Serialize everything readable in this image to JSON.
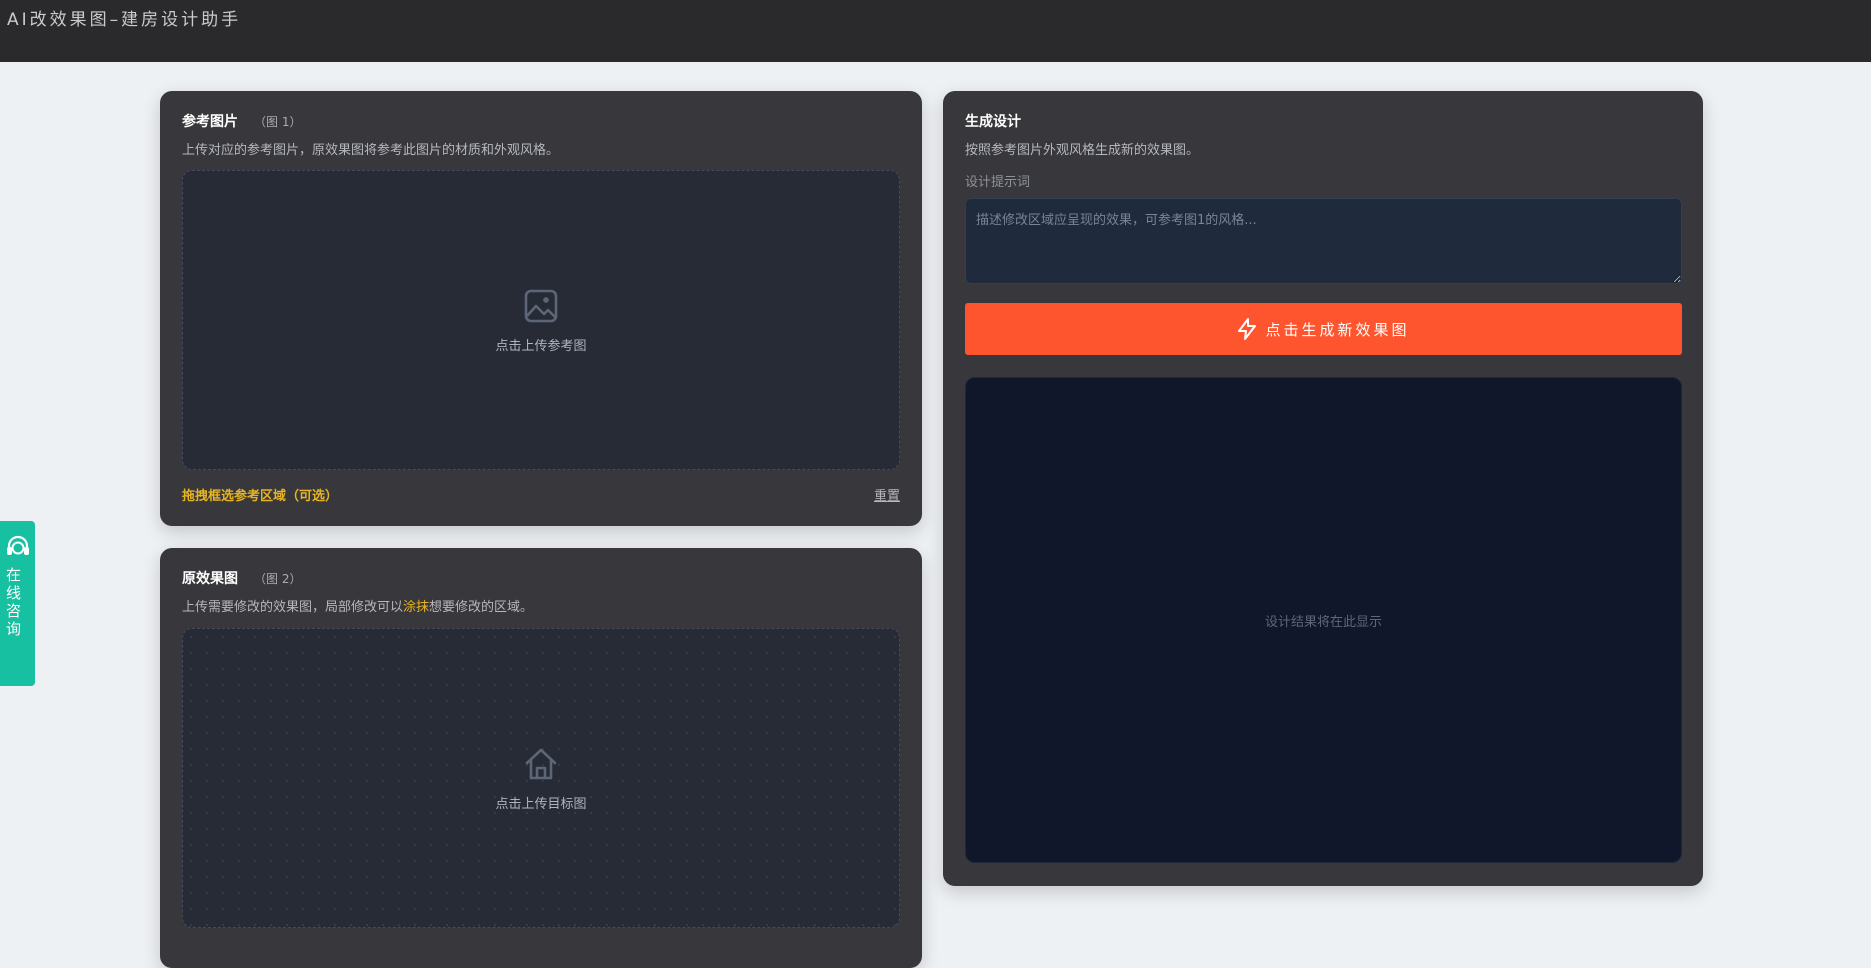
{
  "app": {
    "title": "AI改效果图–建房设计助手"
  },
  "reference_card": {
    "title": "参考图片",
    "tag": "（图 1）",
    "desc": "上传对应的参考图片，原效果图将参考此图片的材质和外观风格。",
    "upload_text": "点击上传参考图",
    "drag_label": "拖拽框选参考区域（可选）",
    "reset_label": "重置"
  },
  "original_card": {
    "title": "原效果图",
    "tag": "（图 2）",
    "desc_before": "上传需要修改的效果图，局部修改可以",
    "desc_highlight": "涂抹",
    "desc_after": "想要修改的区域。",
    "upload_text": "点击上传目标图"
  },
  "generate_card": {
    "title": "生成设计",
    "desc": "按照参考图片外观风格生成新的效果图。",
    "prompt_label": "设计提示词",
    "prompt_placeholder": "描述修改区域应呈现的效果，可参考图1的风格...",
    "prompt_value": "",
    "button_label": "点击生成新效果图",
    "result_placeholder": "设计结果将在此显示"
  },
  "consult": {
    "label": "在线咨询",
    "icon": "headset-icon"
  },
  "colors": {
    "accent": "#ff552e",
    "highlight": "#e6b422",
    "consult": "#16c0a0",
    "card_bg": "#38373b",
    "topbar": "#2a2a2c"
  }
}
